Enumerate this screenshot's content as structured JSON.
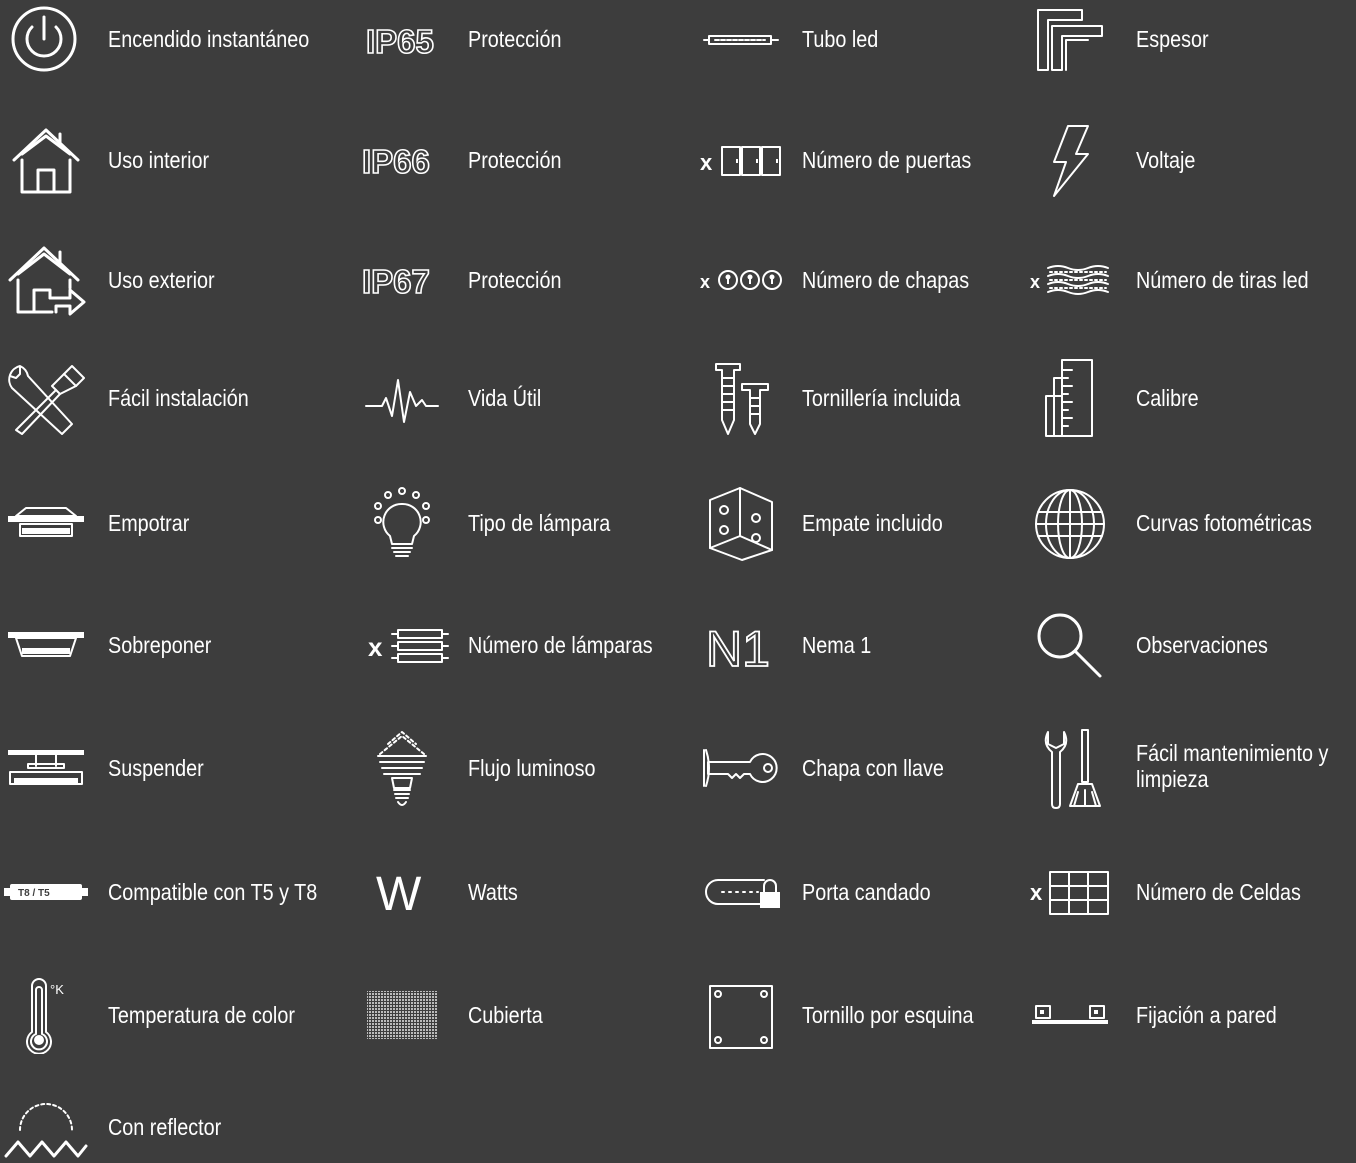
{
  "items": [
    {
      "label": "Encendido instantáneo",
      "icon": "power-icon"
    },
    {
      "label": "Protección",
      "icon": "ip65-icon",
      "icon_text": "IP65"
    },
    {
      "label": "Tubo led",
      "icon": "led-tube-icon"
    },
    {
      "label": "Espesor",
      "icon": "thickness-icon"
    },
    {
      "label": "Uso interior",
      "icon": "indoor-house-icon"
    },
    {
      "label": "Protección",
      "icon": "ip66-icon",
      "icon_text": "IP66"
    },
    {
      "label": "Número de puertas",
      "icon": "doors-count-icon",
      "icon_text": "x"
    },
    {
      "label": "Voltaje",
      "icon": "lightning-icon"
    },
    {
      "label": "Uso exterior",
      "icon": "outdoor-house-icon"
    },
    {
      "label": "Protección",
      "icon": "ip67-icon",
      "icon_text": "IP67"
    },
    {
      "label": "Número de chapas",
      "icon": "locks-count-icon",
      "icon_text": "x"
    },
    {
      "label": "Número de tiras led",
      "icon": "led-strips-count-icon",
      "icon_text": "x"
    },
    {
      "label": "Fácil instalación",
      "icon": "tools-icon"
    },
    {
      "label": "Vida Útil",
      "icon": "lifespan-pulse-icon"
    },
    {
      "label": "Tornillería incluida",
      "icon": "screws-icon"
    },
    {
      "label": "Calibre",
      "icon": "gauge-ruler-icon"
    },
    {
      "label": "Empotrar",
      "icon": "recessed-mount-icon"
    },
    {
      "label": "Tipo de lámpara",
      "icon": "bulb-icon"
    },
    {
      "label": "Empate incluido",
      "icon": "joint-bracket-icon"
    },
    {
      "label": "Curvas fotométricas",
      "icon": "photometric-globe-icon"
    },
    {
      "label": "Sobreponer",
      "icon": "surface-mount-icon"
    },
    {
      "label": "Número de lámparas",
      "icon": "lamps-count-icon",
      "icon_text": "x"
    },
    {
      "label": "Nema 1",
      "icon": "nema1-icon",
      "icon_text": "N1"
    },
    {
      "label": "Observaciones",
      "icon": "magnifier-icon"
    },
    {
      "label": "Suspender",
      "icon": "suspended-mount-icon"
    },
    {
      "label": "Flujo luminoso",
      "icon": "cfl-bulb-icon"
    },
    {
      "label": "Chapa con llave",
      "icon": "key-icon"
    },
    {
      "label": "Fácil mantenimiento y limpieza",
      "icon": "wrench-brush-icon"
    },
    {
      "label": "Compatible con T5 y T8",
      "icon": "t5-t8-tube-icon",
      "icon_text": "T8 / T5"
    },
    {
      "label": "Watts",
      "icon": "watts-icon",
      "icon_text": "W"
    },
    {
      "label": "Porta candado",
      "icon": "padlock-holder-icon"
    },
    {
      "label": "Número de Celdas",
      "icon": "cells-grid-icon",
      "icon_text": "x"
    },
    {
      "label": "Temperatura de color",
      "icon": "thermometer-icon",
      "icon_text": "°K"
    },
    {
      "label": "Cubierta",
      "icon": "cover-mesh-icon"
    },
    {
      "label": "Tornillo por esquina",
      "icon": "corner-screws-icon"
    },
    {
      "label": "Fijación a pared",
      "icon": "wall-mount-icon"
    },
    {
      "label": "Con reflector",
      "icon": "reflector-icon"
    }
  ],
  "colors": {
    "background": "#3d3d3d",
    "foreground": "#ffffff"
  }
}
